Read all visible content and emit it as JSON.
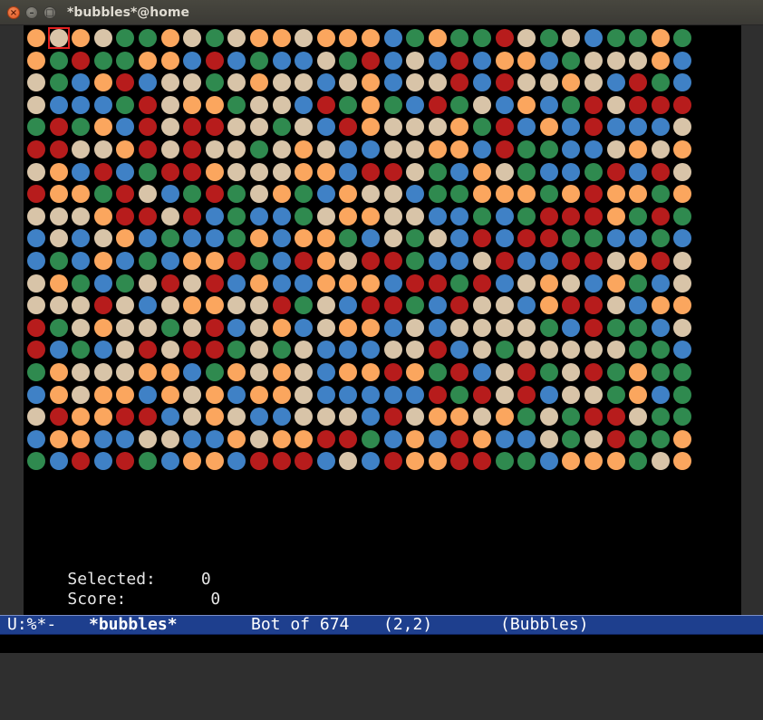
{
  "window": {
    "title": "*bubbles*@home",
    "buttons": {
      "close": "×",
      "minimize": "–",
      "maximize": "□"
    }
  },
  "board": {
    "rows": 20,
    "cols": 30,
    "colors": {
      "O": "#fba65e",
      "T": "#d8c4a8",
      "G": "#2f8a4f",
      "B": "#3f81c6",
      "R": "#b71c1c"
    },
    "cursor": {
      "row": 0,
      "col": 1
    },
    "grid": [
      "OTOTGGOTGTOOTOOOBGOGGRTGTBGGOGT",
      "OGRGGOOBRBGBBTGRBTBRBOOBGTTTOB",
      "TGBORBTTGTOTTBTOBTTRBRTTOTBRGB",
      "TBBBGRTOOGTTBRGOGBRGTBOBGRTRRR",
      "GRGOBRTRRTTGTBROTTTOGRBOBRBBBT",
      "RRTTORTRTTGTOTBBTTOOBRGGBBTOTO",
      "TOBRBGRROTTTOOBRRTGBOTGBBGRBRT",
      "ROOGRTBGRGTOGBOTTBGGOOOGOROOGO",
      "TTTORRTRBGBBGTOOTTBBGBGRRROGRG",
      "BTBTOBGBBGOBOOGBTGTBRBRRGGBBGB",
      "BGBOBGBOORGBROTRRGBBTRBBRRTOR",
      "TOGBGTRTRBOBBOOOBRRGRBTOTBOGBT",
      "TTTRTBTOOTTRGTBRRGBRTTBORRTBOO",
      "RGTOTTGTRBTOBTOOBTBTTTTGBRGGB",
      "RBGBTRTRRGTGTBBBTTRBTGTTTTTGGB",
      "GOTTTOOBGOTOTBOOROGRBTRGTRGOGG",
      "BOTOOBOTOBOOTBBBBBRGRTRBTTGOBG",
      "TROORRBTOTBBTTTBRTOOTOGTGRRTGG",
      "BOOBBTTBBOTOORRGBOBROBBTGTRGGO",
      "GBRBRGBOOBRRRBTBROORRGGBOOOGTO"
    ]
  },
  "status": {
    "selected_label": "Selected:",
    "selected_value": "0",
    "score_label": "Score:",
    "score_value": "0"
  },
  "modeline": {
    "flags": "U:%*-",
    "buffer_name": "*bubbles*",
    "position": "Bot of 674",
    "coords": "(2,2)",
    "mode": "(Bubbles)"
  }
}
